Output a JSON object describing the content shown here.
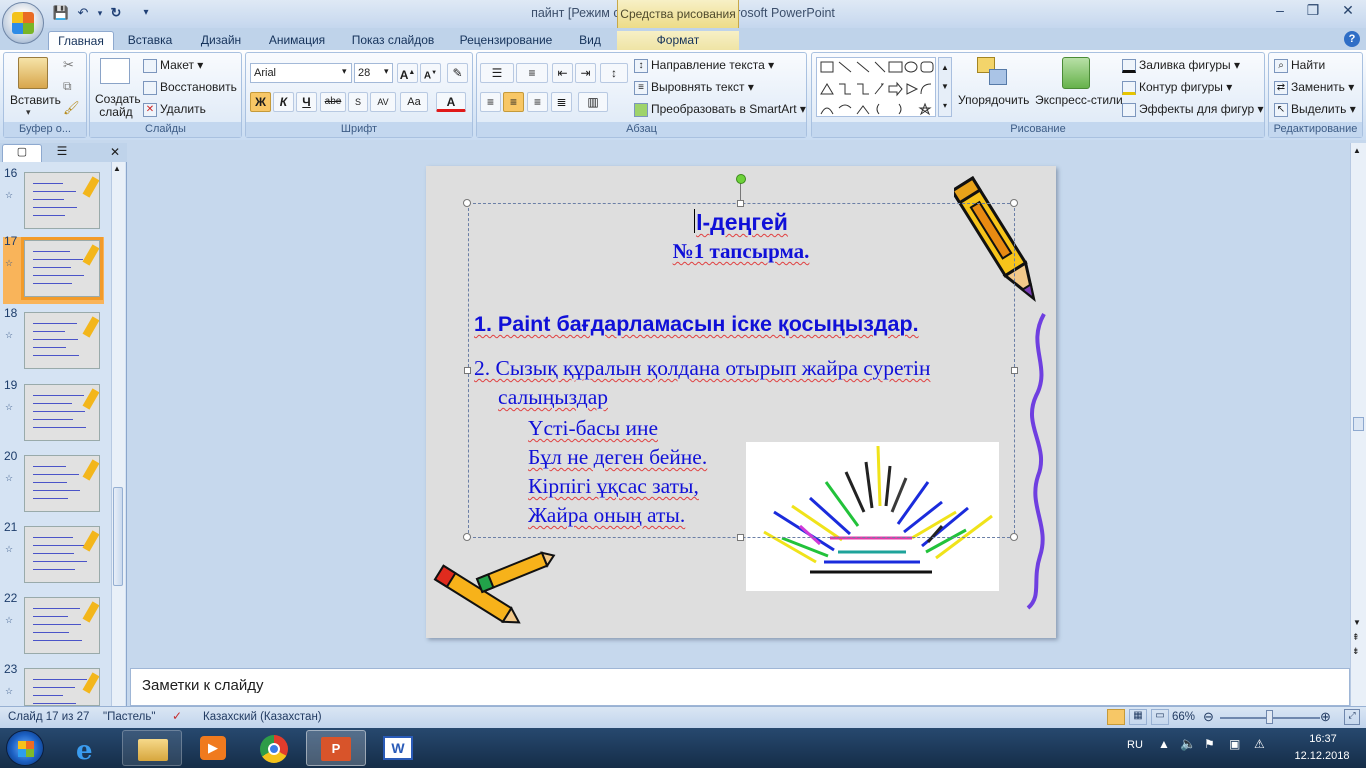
{
  "window": {
    "title": "пайнт [Режим совместимости] - Microsoft PowerPoint",
    "contextual_group": "Средства рисования"
  },
  "tabs": [
    "Главная",
    "Вставка",
    "Дизайн",
    "Анимация",
    "Показ слайдов",
    "Рецензирование",
    "Вид",
    "Формат"
  ],
  "ribbon": {
    "clipboard": {
      "paste": "Вставить",
      "label": "Буфер о..."
    },
    "slides": {
      "new_slide": "Создать слайд",
      "layout": "Макет",
      "reset": "Восстановить",
      "delete": "Удалить",
      "label": "Слайды"
    },
    "font": {
      "family": "Arial",
      "size": "28",
      "bold": "Ж",
      "italic": "К",
      "underline": "Ч",
      "strike": "abe",
      "spacing": "AV",
      "case": "Aa",
      "color": "A",
      "label": "Шрифт"
    },
    "paragraph": {
      "text_direction": "Направление текста",
      "align_text": "Выровнять текст",
      "smartart": "Преобразовать в SmartArt",
      "label": "Абзац"
    },
    "drawing": {
      "arrange": "Упорядочить",
      "quick_styles": "Экспресс-стили",
      "fill": "Заливка фигуры",
      "outline": "Контур фигуры",
      "effects": "Эффекты для фигур",
      "label": "Рисование"
    },
    "editing": {
      "find": "Найти",
      "replace": "Заменить",
      "select": "Выделить",
      "label": "Редактирование"
    }
  },
  "thumbnails": {
    "numbers": [
      "16",
      "17",
      "18",
      "19",
      "20",
      "21",
      "22",
      "23"
    ],
    "selected": "17"
  },
  "slide": {
    "level_title": "I-деңгей",
    "task_title": "№1 тапсырма.",
    "item1": "1. Paint бағдарламасын іске қосыңыздар.",
    "item2_a": "2. Сызық құралын қолдана отырып жайра суретін",
    "item2_b": "салыңыздар",
    "poem": [
      "Үсті-басы ине",
      "Бұл не деген бейне.",
      "Кірпігі ұқсас заты,",
      "Жайра оның аты."
    ]
  },
  "notes_placeholder": "Заметки к слайду",
  "status": {
    "slide_counter": "Слайд 17 из 27",
    "theme": "\"Пастель\"",
    "language": "Казахский (Казахстан)",
    "zoom": "66%",
    "zoom_fraction": 0.66
  },
  "taskbar": {
    "lang": "RU",
    "time": "16:37",
    "date": "12.12.2018"
  },
  "colors": {
    "slide_text": "#1010d8",
    "accent_orange": "#f29b2a",
    "selection_border": "#6b7fa6"
  }
}
